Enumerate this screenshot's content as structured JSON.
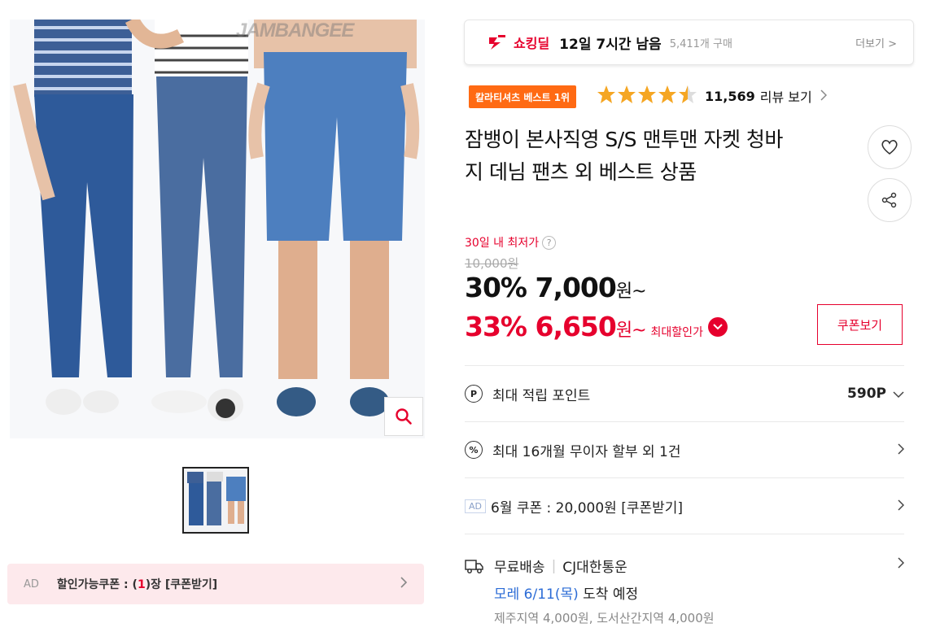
{
  "gallery": {
    "watermark": "JAMBANGEE",
    "zoom_icon": "search-icon",
    "ad_coupon": {
      "ad_label": "AD",
      "prefix": "할인가능쿠폰 : (",
      "count": "1",
      "suffix": ")장 [쿠폰받기]"
    }
  },
  "deal": {
    "label": "쇼킹딜",
    "time_left": "12일 7시간 남음",
    "purchase_count": "5,411개 구매",
    "more": "더보기 >"
  },
  "badge": "칼라티셔츠 베스트 1위",
  "rating": {
    "stars": 4.5,
    "review_count": "11,569",
    "review_label": "리뷰 보기"
  },
  "product": {
    "title_line1": "잠뱅이 본사직영 S/S 맨투맨 자켓 청바",
    "title_line2": "지 데님 팬츠 외 베스트 상품"
  },
  "price": {
    "lowest_label": "30일 내 최저가",
    "original": "10,000원",
    "sale_text": "30% 7,000",
    "won": "원~",
    "max_sale_text": "33% 6,650",
    "max_label": "최대할인가",
    "coupon_button": "쿠폰보기"
  },
  "rows": {
    "points": {
      "icon": "P",
      "label": "최대 적립 포인트",
      "value": "590P"
    },
    "installment": {
      "icon": "%",
      "label": "최대 16개월 무이자 할부 외 1건"
    },
    "coupon": {
      "ad": "AD",
      "label": "6월 쿠폰 : 20,000원 [쿠폰받기]"
    }
  },
  "shipping": {
    "type": "무료배송",
    "carrier": "CJ대한통운",
    "date": "모레 6/11(목)",
    "arrival": " 도착 예정",
    "extra": "제주지역 4,000원, 도서산간지역 4,000원"
  },
  "colors": {
    "accent": "#e6002d",
    "badge": "#ff6a13",
    "star": "#f5a623",
    "link": "#2c6cd6"
  }
}
